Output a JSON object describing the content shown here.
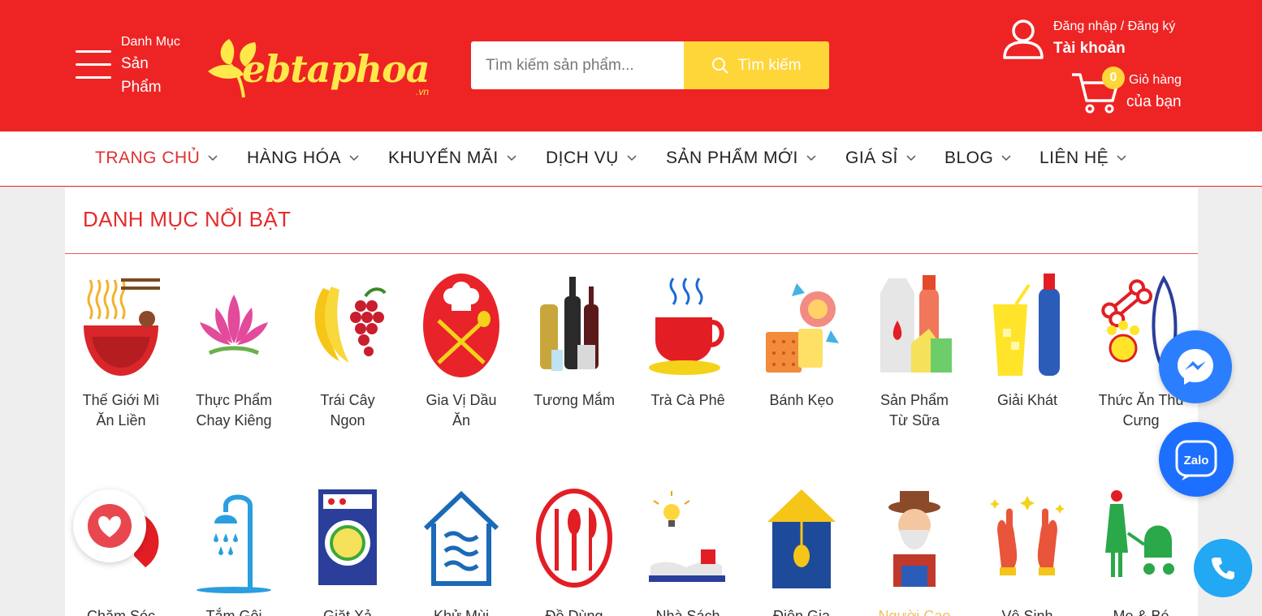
{
  "header": {
    "menu_label_line1": "Danh Mục",
    "menu_label_line2": "Sản",
    "menu_label_line3": "Phẩm",
    "logo_text": "ebtaphoa",
    "logo_suffix": ".vn",
    "search_placeholder": "Tìm kiếm sản phẩm...",
    "search_button": "Tìm kiếm",
    "login_text": "Đăng nhập / Đăng ký",
    "account_text": "Tài khoản",
    "cart_count": "0",
    "cart_line1": "Giỏ hàng",
    "cart_line2": "của bạn"
  },
  "nav": {
    "items": [
      {
        "label": "TRANG CHỦ"
      },
      {
        "label": "HÀNG HÓA"
      },
      {
        "label": "KHUYẾN MÃI"
      },
      {
        "label": "DỊCH VỤ"
      },
      {
        "label": "SẢN PHẨM MỚI"
      },
      {
        "label": "GIÁ SỈ"
      },
      {
        "label": "BLOG"
      },
      {
        "label": "LIÊN HỆ"
      }
    ]
  },
  "featured": {
    "title": "DANH MỤC NỔI BẬT",
    "row1": [
      {
        "label": "Thế Giới Mì Ăn Liền",
        "icon": "noodle-bowl-icon"
      },
      {
        "label": "Thực Phẩm Chay Kiêng",
        "icon": "lotus-icon"
      },
      {
        "label": "Trái Cây Ngon",
        "icon": "fruit-icon"
      },
      {
        "label": "Gia Vị Dầu Ăn",
        "icon": "chef-hat-icon"
      },
      {
        "label": "Tương Mắm",
        "icon": "bottles-icon"
      },
      {
        "label": "Trà Cà Phê",
        "icon": "coffee-cup-icon"
      },
      {
        "label": "Bánh Kẹo",
        "icon": "candy-icon"
      },
      {
        "label": "Sản Phẩm Từ Sữa",
        "icon": "milk-icon"
      },
      {
        "label": "Giải Khát",
        "icon": "drinks-icon"
      },
      {
        "label": "Thức Ăn Thú Cưng",
        "icon": "pet-food-icon"
      }
    ],
    "row2": [
      {
        "label": "Chăm Sóc",
        "icon": "care-icon"
      },
      {
        "label": "Tắm Gội",
        "icon": "shower-icon"
      },
      {
        "label": "Giặt Xả",
        "icon": "washing-machine-icon"
      },
      {
        "label": "Khử Mùi",
        "icon": "house-air-icon"
      },
      {
        "label": "Đồ Dùng",
        "icon": "cutlery-icon"
      },
      {
        "label": "Nhà Sách",
        "icon": "book-lamp-icon"
      },
      {
        "label": "Điện Gia",
        "icon": "lamp-house-icon"
      },
      {
        "label": "Người Cao",
        "icon": "old-man-icon"
      },
      {
        "label": "Vệ Sinh",
        "icon": "gloves-icon"
      },
      {
        "label": "Mẹ & Bé",
        "icon": "stroller-icon"
      }
    ]
  },
  "floating": {
    "zalo_label": "Zalo"
  }
}
